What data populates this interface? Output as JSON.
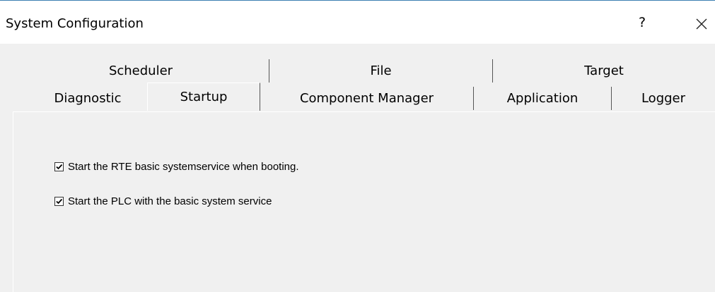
{
  "window": {
    "title": "System Configuration",
    "help_label": "?"
  },
  "tabs": {
    "back_row": [
      {
        "label": "Scheduler"
      },
      {
        "label": "File"
      },
      {
        "label": "Target"
      }
    ],
    "front_row": [
      {
        "label": "Diagnostic"
      },
      {
        "label": "Startup",
        "selected": true
      },
      {
        "label": "Component Manager"
      },
      {
        "label": "Application"
      },
      {
        "label": "Logger"
      }
    ]
  },
  "startup": {
    "options": [
      {
        "label": "Start the RTE basic systemservice when booting.",
        "checked": true
      },
      {
        "label": "Start the PLC with the basic system service",
        "checked": true
      }
    ]
  }
}
